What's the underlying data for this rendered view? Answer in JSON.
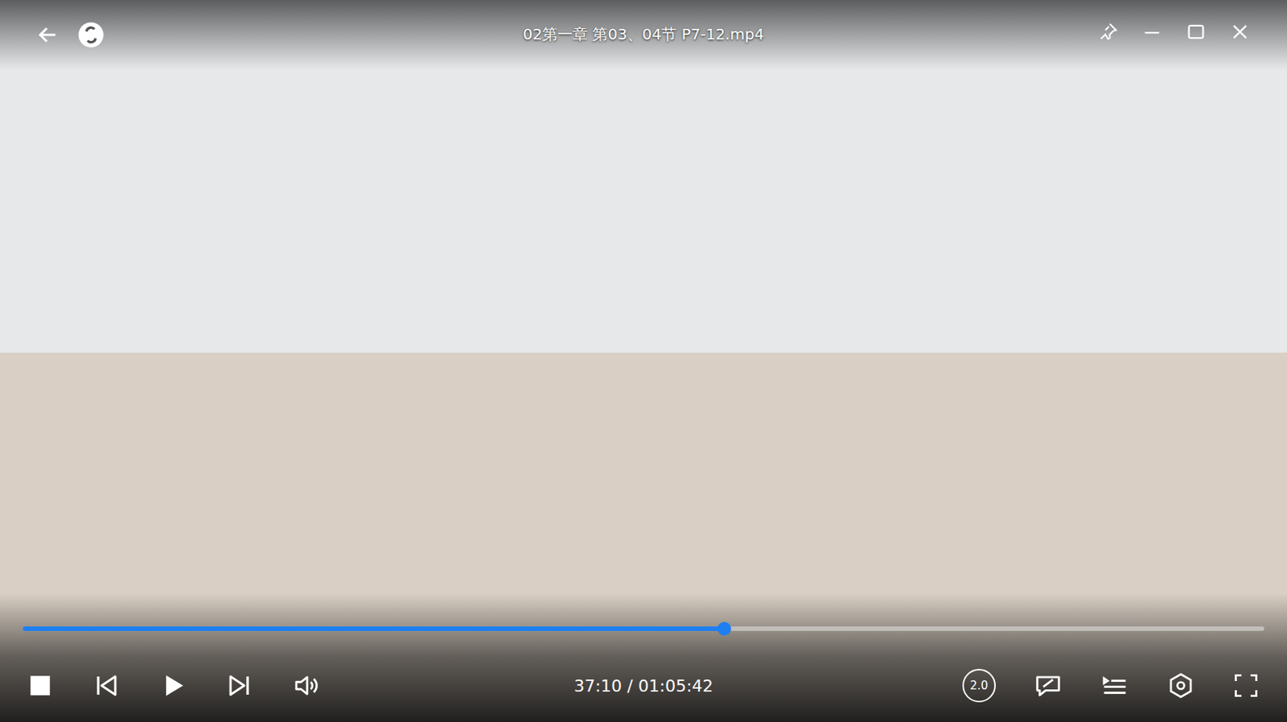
{
  "window": {
    "title": "02第一章 第03、04节 P7-12.mp4"
  },
  "controls": {
    "paused": true,
    "progress": {
      "level": 0.565
    },
    "time": "37:10 / 01:05:42",
    "speed": "2.0"
  }
}
